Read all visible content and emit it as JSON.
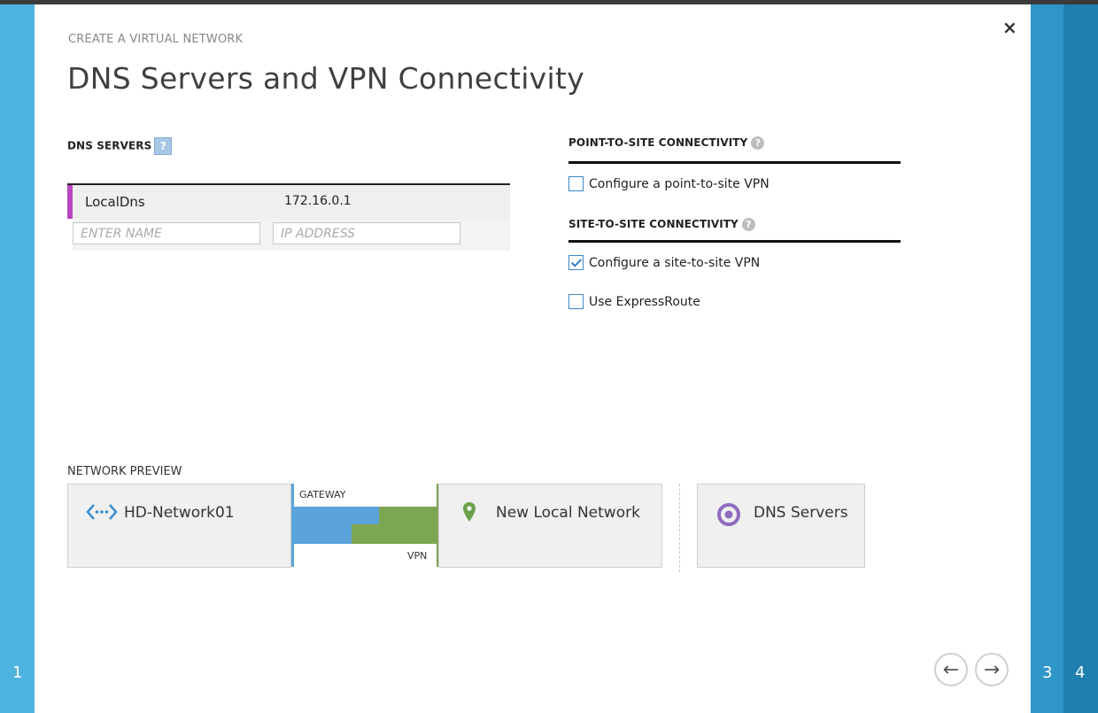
{
  "wizard": {
    "breadcrumb": "CREATE A VIRTUAL NETWORK",
    "title": "DNS Servers and VPN Connectivity",
    "close_glyph": "×",
    "steps": {
      "left": "1",
      "right1": "3",
      "right2": "4"
    }
  },
  "dns": {
    "label": "DNS SERVERS",
    "help": "?",
    "rows": [
      {
        "name": "LocalDns",
        "ip": "172.16.0.1"
      }
    ],
    "name_placeholder": "ENTER NAME",
    "ip_placeholder": "IP ADDRESS"
  },
  "point_to_site": {
    "label": "POINT-TO-SITE CONNECTIVITY",
    "help": "?",
    "option": {
      "label": "Configure a point-to-site VPN",
      "checked": false
    }
  },
  "site_to_site": {
    "label": "SITE-TO-SITE CONNECTIVITY",
    "help": "?",
    "options": [
      {
        "label": "Configure a site-to-site VPN",
        "checked": true
      },
      {
        "label": "Use ExpressRoute",
        "checked": false
      }
    ]
  },
  "preview": {
    "label": "NETWORK PREVIEW",
    "network_name": "HD-Network01",
    "gateway_label": "GATEWAY",
    "vpn_label": "VPN",
    "local_network": "New Local Network",
    "dns_servers": "DNS Servers",
    "colors": {
      "gateway_blue": "#5ba3db",
      "vpn_green": "#7da653",
      "dns_purple": "#8e6bbf",
      "accent_magenta": "#b748c1"
    }
  },
  "nav": {
    "back_glyph": "←",
    "next_glyph": "→"
  }
}
